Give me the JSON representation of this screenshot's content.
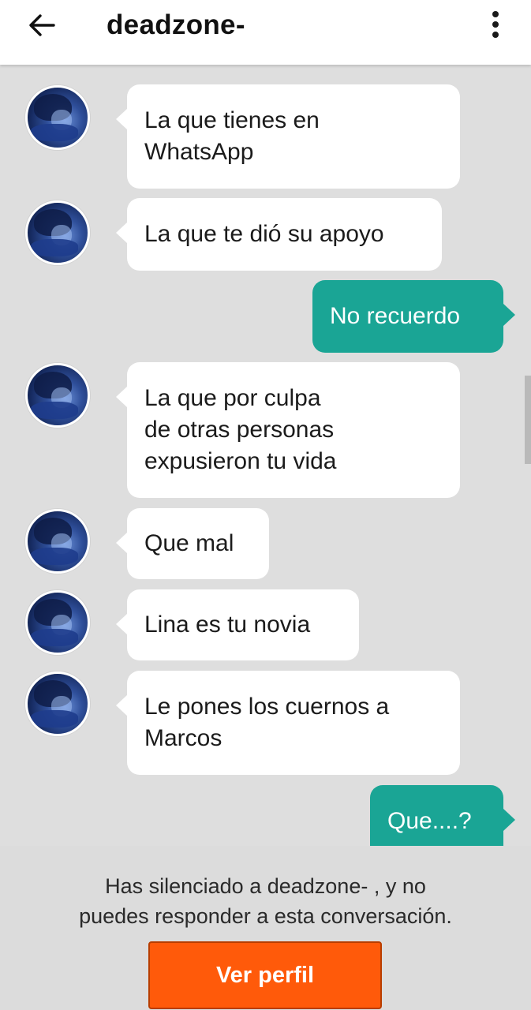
{
  "header": {
    "title": "deadzone-",
    "back_icon": "arrow-left-icon",
    "menu_icon": "more-vertical-icon"
  },
  "messages": [
    {
      "direction": "incoming",
      "text": "La que tienes en\nWhatsApp"
    },
    {
      "direction": "incoming",
      "text": "La que te dió su apoyo"
    },
    {
      "direction": "outgoing",
      "text": "No recuerdo"
    },
    {
      "direction": "incoming",
      "text": "La que por culpa\nde otras personas\nexpusieron tu vida"
    },
    {
      "direction": "incoming",
      "text": "Que mal"
    },
    {
      "direction": "incoming",
      "text": "Lina es tu novia"
    },
    {
      "direction": "incoming",
      "text": "Le pones los cuernos a\nMarcos"
    },
    {
      "direction": "outgoing",
      "text": "Que....?"
    }
  ],
  "footer": {
    "notice": "Has silenciado a deadzone- , y no\npuedes responder a esta conversación.",
    "button_label": "Ver perfil"
  },
  "colors": {
    "background": "#dedede",
    "incoming_bubble": "#ffffff",
    "outgoing_bubble": "#1aa595",
    "button": "#ff5a0a"
  }
}
